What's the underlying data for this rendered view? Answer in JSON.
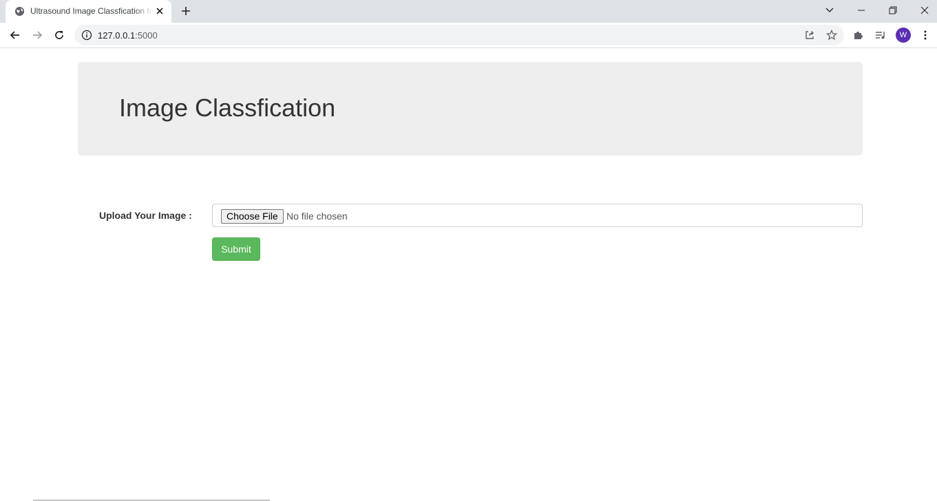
{
  "browser": {
    "tab": {
      "title": "Ultrasound Image Classfication for Kidney",
      "favicon": "globe-icon"
    },
    "new_tab_icon": "plus-icon",
    "window_controls": [
      "tab-search-icon",
      "minimize-icon",
      "restore-icon",
      "close-icon"
    ],
    "address_bar": {
      "host": "127.0.0.1",
      "port": ":5000",
      "icon": "info-icon"
    },
    "toolbar_icons": [
      "back-icon",
      "forward-icon",
      "reload-icon",
      "share-icon",
      "star-icon",
      "puzzle-icon",
      "reading-list-icon",
      "more-icon"
    ],
    "profile_initial": "W",
    "profile_color": "#5b2fb5"
  },
  "page": {
    "heading": "Image Classfication",
    "form": {
      "label": "Upload Your Image :",
      "choose_file_label": "Choose File",
      "file_status": "No file chosen",
      "submit_label": "Submit"
    }
  },
  "colors": {
    "jumbotron_bg": "#eeeeee",
    "submit_bg": "#5cb85c",
    "tabstrip_bg": "#dee1e6"
  }
}
